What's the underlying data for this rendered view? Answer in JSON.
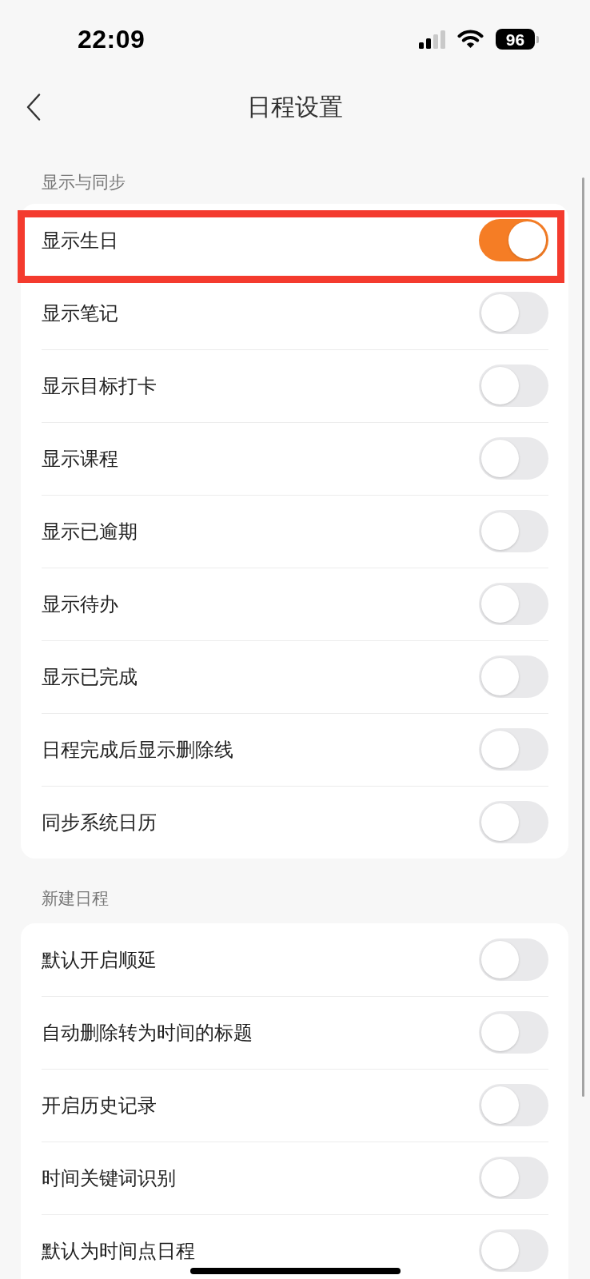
{
  "status_bar": {
    "time": "22:09",
    "battery": "96"
  },
  "nav": {
    "title": "日程设置"
  },
  "sections": [
    {
      "title": "显示与同步",
      "rows": [
        {
          "label": "显示生日",
          "on": true,
          "highlighted": true
        },
        {
          "label": "显示笔记",
          "on": false,
          "highlighted": false
        },
        {
          "label": "显示目标打卡",
          "on": false,
          "highlighted": false
        },
        {
          "label": "显示课程",
          "on": false,
          "highlighted": false
        },
        {
          "label": "显示已逾期",
          "on": false,
          "highlighted": false
        },
        {
          "label": "显示待办",
          "on": false,
          "highlighted": false
        },
        {
          "label": "显示已完成",
          "on": false,
          "highlighted": false
        },
        {
          "label": "日程完成后显示删除线",
          "on": false,
          "highlighted": false
        },
        {
          "label": "同步系统日历",
          "on": false,
          "highlighted": false
        }
      ]
    },
    {
      "title": "新建日程",
      "rows": [
        {
          "label": "默认开启顺延",
          "on": false,
          "highlighted": false
        },
        {
          "label": "自动删除转为时间的标题",
          "on": false,
          "highlighted": false
        },
        {
          "label": "开启历史记录",
          "on": false,
          "highlighted": false
        },
        {
          "label": "时间关键词识别",
          "on": false,
          "highlighted": false
        },
        {
          "label": "默认为时间点日程",
          "on": false,
          "highlighted": false
        }
      ]
    }
  ]
}
